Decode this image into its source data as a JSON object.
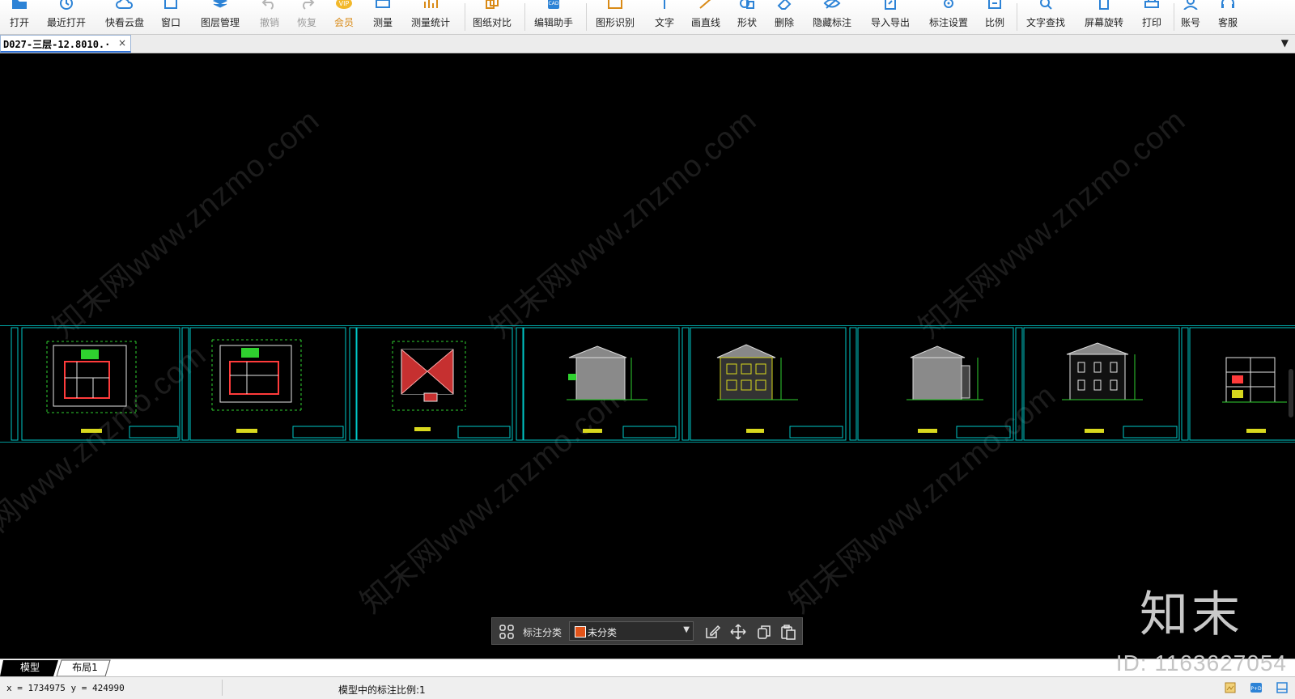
{
  "toolbar": {
    "items": [
      {
        "label": "打开",
        "icon": "open-folder-icon"
      },
      {
        "label": "最近打开",
        "icon": "recent-clock-icon"
      },
      {
        "label": "快看云盘",
        "icon": "cloud-icon"
      },
      {
        "label": "窗口",
        "icon": "window-icon"
      },
      {
        "label": "图层管理",
        "icon": "layers-icon"
      },
      {
        "label": "撤销",
        "icon": "undo-icon"
      },
      {
        "label": "恢复",
        "icon": "redo-icon"
      },
      {
        "label": "会员",
        "icon": "vip-icon"
      },
      {
        "label": "测量",
        "icon": "ruler-icon"
      },
      {
        "label": "测量统计",
        "icon": "measure-stats-icon"
      },
      {
        "label": "图纸对比",
        "icon": "compare-icon"
      },
      {
        "label": "编辑助手",
        "icon": "cad-edit-icon"
      },
      {
        "label": "图形识别",
        "icon": "shape-recognize-icon"
      },
      {
        "label": "文字",
        "icon": "text-icon"
      },
      {
        "label": "画直线",
        "icon": "line-icon"
      },
      {
        "label": "形状",
        "icon": "shape-icon"
      },
      {
        "label": "删除",
        "icon": "eraser-icon"
      },
      {
        "label": "隐藏标注",
        "icon": "hide-eye-icon"
      },
      {
        "label": "导入导出",
        "icon": "import-export-icon"
      },
      {
        "label": "标注设置",
        "icon": "annotation-settings-icon"
      },
      {
        "label": "比例",
        "icon": "scale-icon"
      },
      {
        "label": "文字查找",
        "icon": "text-search-icon"
      },
      {
        "label": "屏幕旋转",
        "icon": "rotate-screen-icon"
      },
      {
        "label": "打印",
        "icon": "printer-icon"
      },
      {
        "label": "账号",
        "icon": "user-icon"
      },
      {
        "label": "客服",
        "icon": "headset-icon"
      }
    ]
  },
  "document_tab": {
    "title": "D027-三层-12.8010.·",
    "close": "×"
  },
  "tab_menu_arrow": "▼",
  "watermark_text": "知末网www.znzmo.com",
  "brand_logo": "知末",
  "float_bar": {
    "label": "标注分类",
    "select_value": "未分类",
    "swatch_color": "#e2541a"
  },
  "layout_tabs": [
    "模型",
    "布局1"
  ],
  "id_text": "ID: 1163627054",
  "status": {
    "coordinates": "x = 1734975  y = 424990",
    "scale_text": "模型中的标注比例:1"
  },
  "colors": {
    "canvas": "#000000",
    "frame": "#00c8c8",
    "floor_plan": "#ff3b3b",
    "dimension": "#2fd12f",
    "facade_yellow": "#d8d81e"
  }
}
